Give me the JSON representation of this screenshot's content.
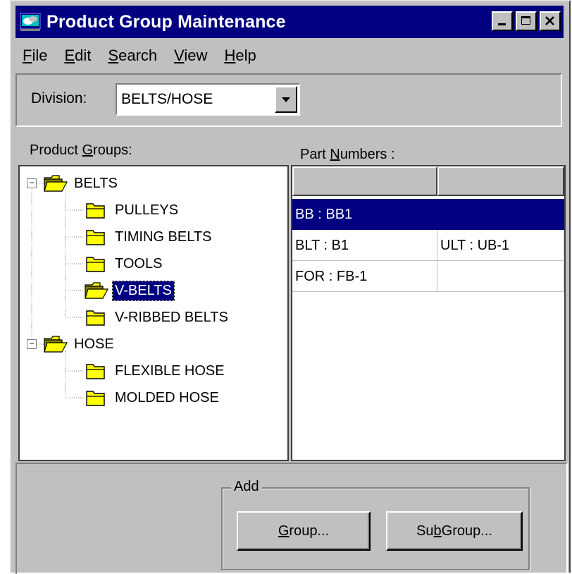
{
  "window": {
    "title": "Product Group Maintenance",
    "controls": {
      "minimize": "minimize",
      "maximize": "maximize",
      "close": "close"
    }
  },
  "menu": {
    "items": [
      {
        "pre": "",
        "key": "F",
        "post": "ile"
      },
      {
        "pre": "",
        "key": "E",
        "post": "dit"
      },
      {
        "pre": "",
        "key": "S",
        "post": "earch"
      },
      {
        "pre": "",
        "key": "V",
        "post": "iew"
      },
      {
        "pre": "",
        "key": "H",
        "post": "elp"
      }
    ]
  },
  "division": {
    "label": "Division:",
    "value": "BELTS/HOSE"
  },
  "product_groups": {
    "label_pre": "Product ",
    "label_key": "G",
    "label_post": "roups:",
    "tree": [
      {
        "label": "BELTS",
        "level": 0,
        "expanded": true,
        "open": true
      },
      {
        "label": "PULLEYS",
        "level": 1,
        "open": false
      },
      {
        "label": "TIMING BELTS",
        "level": 1,
        "open": false
      },
      {
        "label": "TOOLS",
        "level": 1,
        "open": false
      },
      {
        "label": "V-BELTS",
        "level": 1,
        "open": true,
        "selected": true
      },
      {
        "label": "V-RIBBED BELTS",
        "level": 1,
        "open": false
      },
      {
        "label": "HOSE",
        "level": 0,
        "expanded": true,
        "open": true
      },
      {
        "label": "FLEXIBLE HOSE",
        "level": 1,
        "open": false
      },
      {
        "label": "MOLDED HOSE",
        "level": 1,
        "open": false
      }
    ]
  },
  "part_numbers": {
    "label_pre": "Part ",
    "label_key": "N",
    "label_post": "umbers :",
    "rows": [
      {
        "cells": [
          "BB : BB1",
          ""
        ],
        "selected": true
      },
      {
        "cells": [
          "BLT : B1",
          "ULT : UB-1"
        ],
        "selected": false
      },
      {
        "cells": [
          "FOR : FB-1",
          ""
        ],
        "selected": false
      }
    ]
  },
  "add": {
    "label": "Add",
    "group_button": {
      "pre": "",
      "key": "G",
      "post": "roup..."
    },
    "subgroup_button": {
      "pre": "Su",
      "key": "b",
      "post": " Group..."
    }
  },
  "colors": {
    "titlebar": "#000080",
    "selection": "#000080",
    "face": "#c0c0c0",
    "folder": "#ffff00"
  },
  "icons": {
    "app": "app-icon",
    "folder_closed": "folder-closed-icon",
    "folder_open": "folder-open-icon",
    "dropdown": "chevron-down-icon",
    "expander": "collapse-icon"
  }
}
